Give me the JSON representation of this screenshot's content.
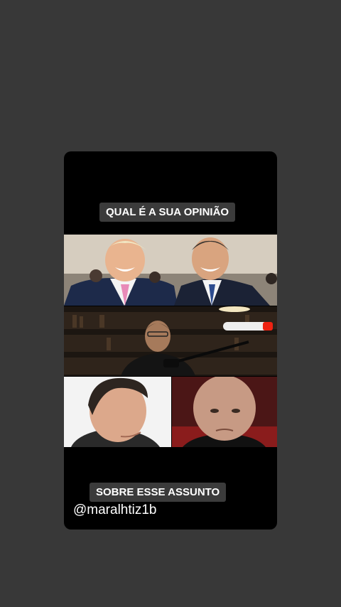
{
  "story": {
    "caption_top": "QUAL É A SUA OPINIÃO",
    "caption_bottom": "SOBRE ESSE ASSUNTO",
    "handle": "@maralhtiz1b"
  },
  "colors": {
    "background": "#383838",
    "card": "#000000",
    "caption_bg": "#3b3b3b"
  }
}
